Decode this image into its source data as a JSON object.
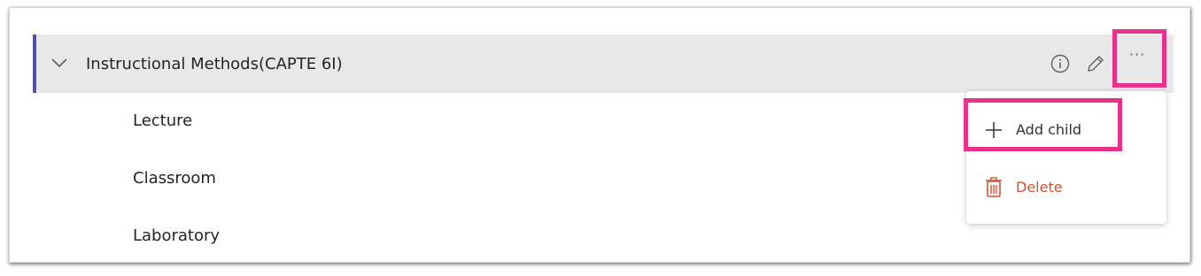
{
  "node": {
    "title": "Instructional Methods(CAPTE 6I)",
    "children": [
      "Lecture",
      "Classroom",
      "Laboratory"
    ]
  },
  "actions": {
    "more_label": "···"
  },
  "menu": {
    "add_child": "Add child",
    "delete": "Delete"
  },
  "icons": [
    "chevron-down-icon",
    "info-icon",
    "pencil-icon",
    "more-icon",
    "plus-icon",
    "trash-icon"
  ],
  "colors": {
    "accent": "#4f52b2",
    "highlight": "#e8318a",
    "danger": "#d9502c",
    "row_bg": "#e8e8e8"
  }
}
